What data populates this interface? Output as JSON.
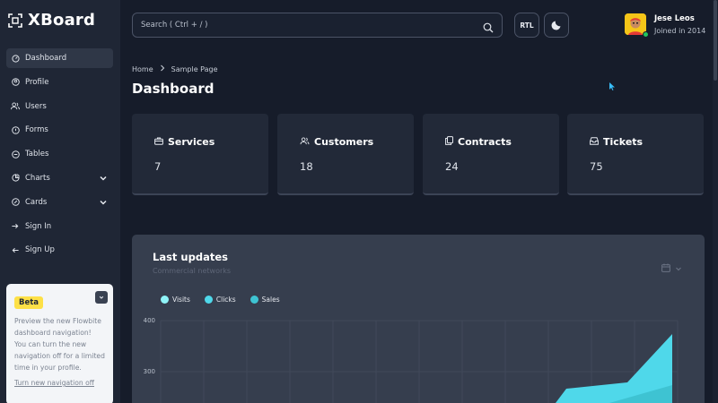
{
  "app": {
    "name": "XBoard"
  },
  "sidebar": {
    "items": [
      {
        "label": "Dashboard",
        "icon": "dashboard-icon"
      },
      {
        "label": "Profile",
        "icon": "profile-icon"
      },
      {
        "label": "Users",
        "icon": "users-icon"
      },
      {
        "label": "Forms",
        "icon": "forms-icon"
      },
      {
        "label": "Tables",
        "icon": "tables-icon"
      },
      {
        "label": "Charts",
        "icon": "charts-icon"
      },
      {
        "label": "Cards",
        "icon": "cards-icon"
      },
      {
        "label": "Sign In",
        "icon": "sign-in-icon"
      },
      {
        "label": "Sign Up",
        "icon": "sign-up-icon"
      }
    ]
  },
  "beta": {
    "badge": "Beta",
    "text": "Preview the new Flowbite dashboard navigation! You can turn the new navigation off for a limited time in your profile.",
    "link": "Turn new navigation off"
  },
  "header": {
    "search_placeholder": "Search ( Ctrl + / )",
    "rtl_label": "RTL",
    "user_name": "Jese Leos",
    "user_sub": "Joined in 2014"
  },
  "breadcrumb": {
    "home": "Home",
    "current": "Sample Page"
  },
  "page": {
    "title": "Dashboard"
  },
  "stats": [
    {
      "label": "Services",
      "value": "7",
      "icon": "briefcase-icon"
    },
    {
      "label": "Customers",
      "value": "18",
      "icon": "users-icon"
    },
    {
      "label": "Contracts",
      "value": "24",
      "icon": "copy-icon"
    },
    {
      "label": "Tickets",
      "value": "75",
      "icon": "inbox-icon"
    }
  ],
  "panel": {
    "title": "Last updates",
    "subtitle": "Commercial networks"
  },
  "colors": {
    "background": "#161c2a",
    "sidebar": "#1f2635",
    "card": "#222938",
    "panel": "#363e4e",
    "accent_cyan": "#5ee3f0",
    "badge_yellow": "#fde047"
  },
  "chart_data": {
    "type": "area",
    "series": [
      {
        "name": "Visits",
        "color": "#8ff3f8"
      },
      {
        "name": "Clicks",
        "color": "#4fd8ea"
      },
      {
        "name": "Sales",
        "color": "#3ec3d2"
      }
    ],
    "yticks": [
      400,
      300
    ],
    "grid": true,
    "legend": "top-left",
    "visible_area": [
      {
        "x_index": 0,
        "y": 0
      },
      {
        "x_index": 10,
        "y": 200
      },
      {
        "x_index": 11,
        "y": 210
      },
      {
        "x_index": 12,
        "y": 375
      }
    ]
  }
}
